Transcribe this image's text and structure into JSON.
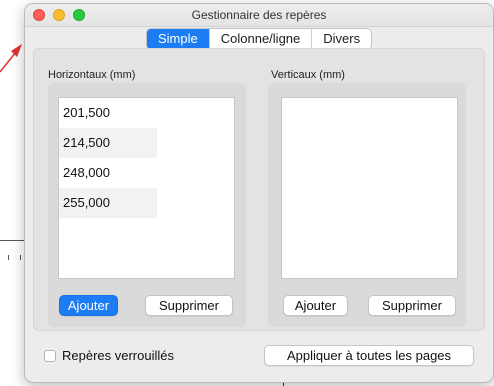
{
  "window": {
    "title": "Gestionnaire des repères"
  },
  "tabs": [
    {
      "label": "Simple",
      "active": true
    },
    {
      "label": "Colonne/ligne",
      "active": false
    },
    {
      "label": "Divers",
      "active": false
    }
  ],
  "horizontal": {
    "label": "Horizontaux (mm)",
    "items": [
      "201,500",
      "214,500",
      "248,000",
      "255,000"
    ],
    "add_label": "Ajouter",
    "remove_label": "Supprimer"
  },
  "vertical": {
    "label": "Verticaux (mm)",
    "items": [],
    "add_label": "Ajouter",
    "remove_label": "Supprimer"
  },
  "footer": {
    "lock_label": "Repères verrouillés",
    "lock_checked": false,
    "apply_all_label": "Appliquer à toutes les pages"
  },
  "colors": {
    "accent": "#1b7cf3",
    "close": "#fe5f57",
    "minimize": "#febc2e",
    "zoom": "#28c840"
  },
  "icons": [
    "close-icon",
    "minimize-icon",
    "zoom-icon"
  ]
}
